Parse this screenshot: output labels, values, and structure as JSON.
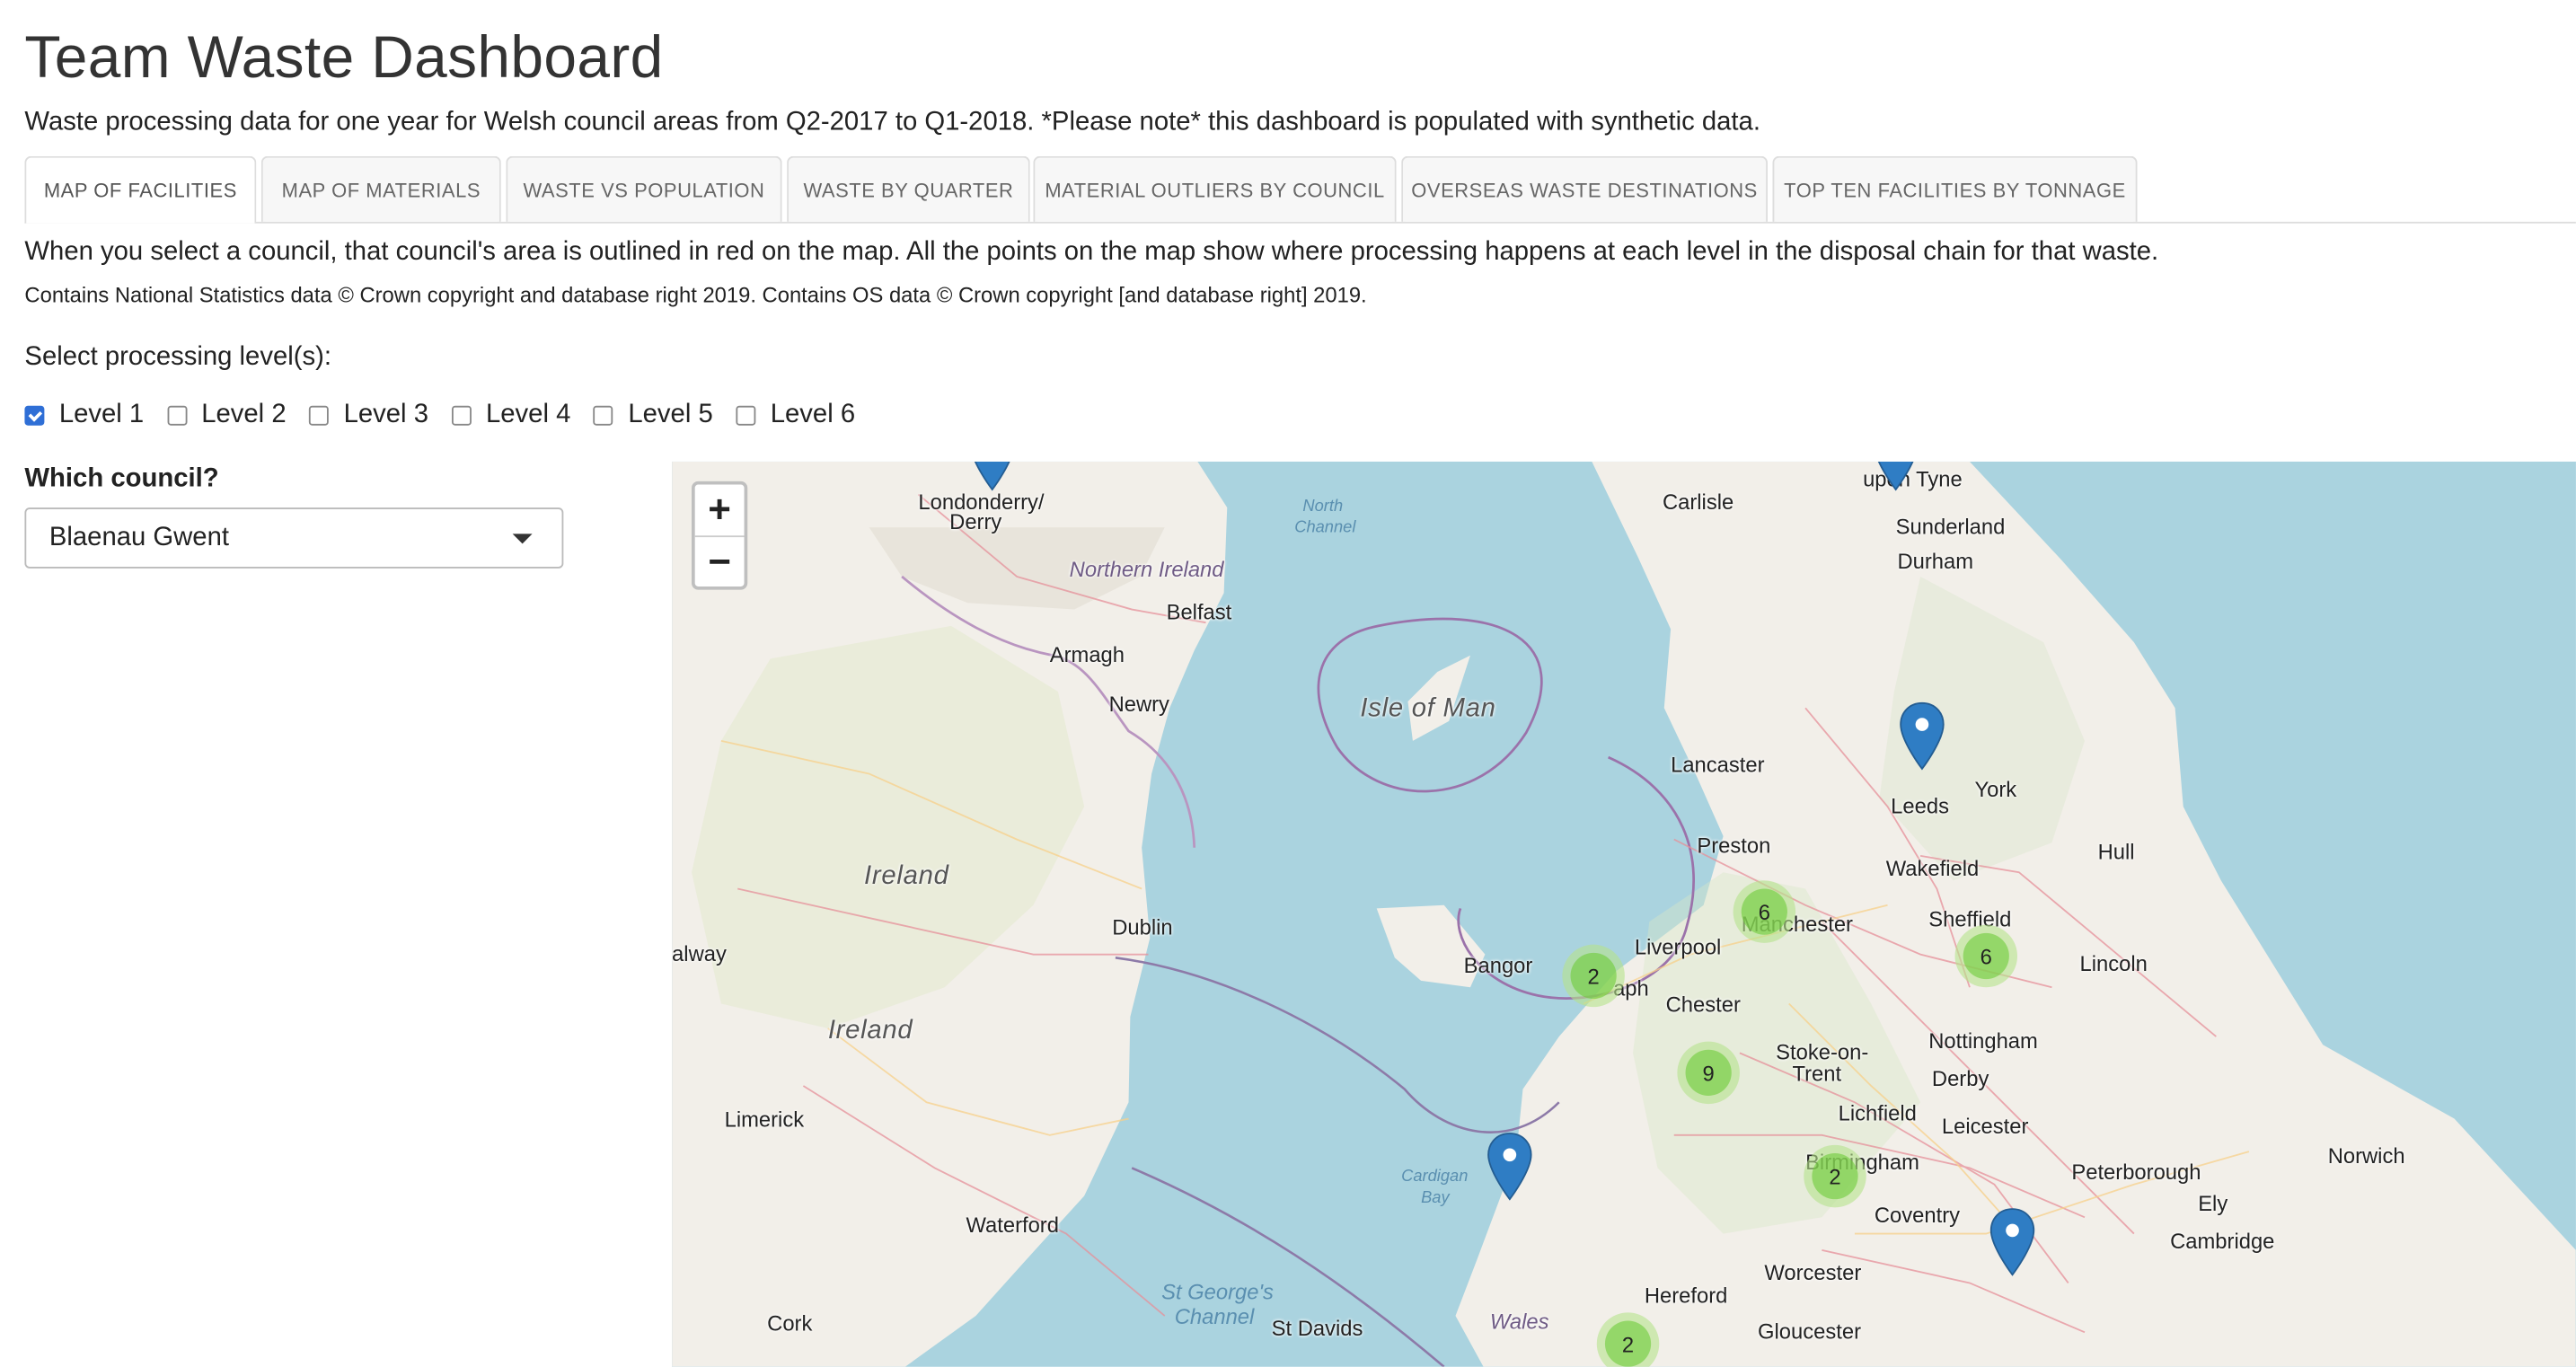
{
  "app": {
    "title": "Team Waste Dashboard",
    "subtitle": "Waste processing data for one year for Welsh council areas from Q2-2017 to Q1-2018. *Please note* this dashboard is populated with synthetic data."
  },
  "tabs": [
    {
      "label": "MAP OF FACILITIES",
      "active": true
    },
    {
      "label": "MAP OF MATERIALS",
      "active": false
    },
    {
      "label": "WASTE VS POPULATION",
      "active": false
    },
    {
      "label": "WASTE BY QUARTER",
      "active": false
    },
    {
      "label": "MATERIAL OUTLIERS BY COUNCIL",
      "active": false
    },
    {
      "label": "OVERSEAS WASTE DESTINATIONS",
      "active": false
    },
    {
      "label": "TOP TEN FACILITIES BY TONNAGE",
      "active": false
    }
  ],
  "content": {
    "note": "When you select a council, that council's area is outlined in red on the map. All the points on the map show where processing happens at each level in the disposal chain for that waste.",
    "copyright": "Contains National Statistics data © Crown copyright and database right 2019. Contains OS data © Crown copyright [and database right] 2019.",
    "level_prompt": "Select processing level(s):",
    "levels": [
      {
        "label": "Level 1",
        "checked": true
      },
      {
        "label": "Level 2",
        "checked": false
      },
      {
        "label": "Level 3",
        "checked": false
      },
      {
        "label": "Level 4",
        "checked": false
      },
      {
        "label": "Level 5",
        "checked": false
      },
      {
        "label": "Level 6",
        "checked": false
      }
    ],
    "council_prompt": "Which council?",
    "council_selected": "Blaenau Gwent"
  },
  "map": {
    "zoom_in": "+",
    "zoom_out": "−",
    "clusters": [
      "6",
      "2",
      "6",
      "9",
      "2",
      "2"
    ],
    "labels": {
      "londonderry": "Londonderry/",
      "derry": "Derry",
      "north": "North",
      "channel": "Channel",
      "northern_ireland": "Northern Ireland",
      "belfast": "Belfast",
      "armagh": "Armagh",
      "newry": "Newry",
      "isle_of_man": "Isle of Man",
      "carlisle": "Carlisle",
      "sunderland": "Sunderland",
      "durham": "Durham",
      "tyne": "upon Tyne",
      "lancaster": "Lancaster",
      "leeds": "Leeds",
      "york": "York",
      "preston": "Preston",
      "wakefield": "Wakefield",
      "hull": "Hull",
      "ireland": "Ireland",
      "dublin": "Dublin",
      "galway": "alway",
      "manchester": "Manchester",
      "sheffield": "Sheffield",
      "liverpool": "Liverpool",
      "bangor": "Bangor",
      "asaph": "aph",
      "lincoln": "Lincoln",
      "chester": "Chester",
      "stoke": "Stoke-on-",
      "trent": "Trent",
      "nottingham": "Nottingham",
      "derby": "Derby",
      "ireland2": "Ireland",
      "limerick": "Limerick",
      "lichfield": "Lichfield",
      "leicester": "Leicester",
      "birmingham": "Birmingham",
      "peterborough": "Peterborough",
      "norwich": "Norwich",
      "cardigan": "Cardigan",
      "bay": "Bay",
      "coventry": "Coventry",
      "ely": "Ely",
      "waterford": "Waterford",
      "cambridge": "Cambridge",
      "worcester": "Worcester",
      "stgeorges": "St George's",
      "channel2": "Channel",
      "hereford": "Hereford",
      "cork": "Cork",
      "stdavids": "St Davids",
      "wales": "Wales",
      "gloucester": "Gloucester"
    }
  }
}
